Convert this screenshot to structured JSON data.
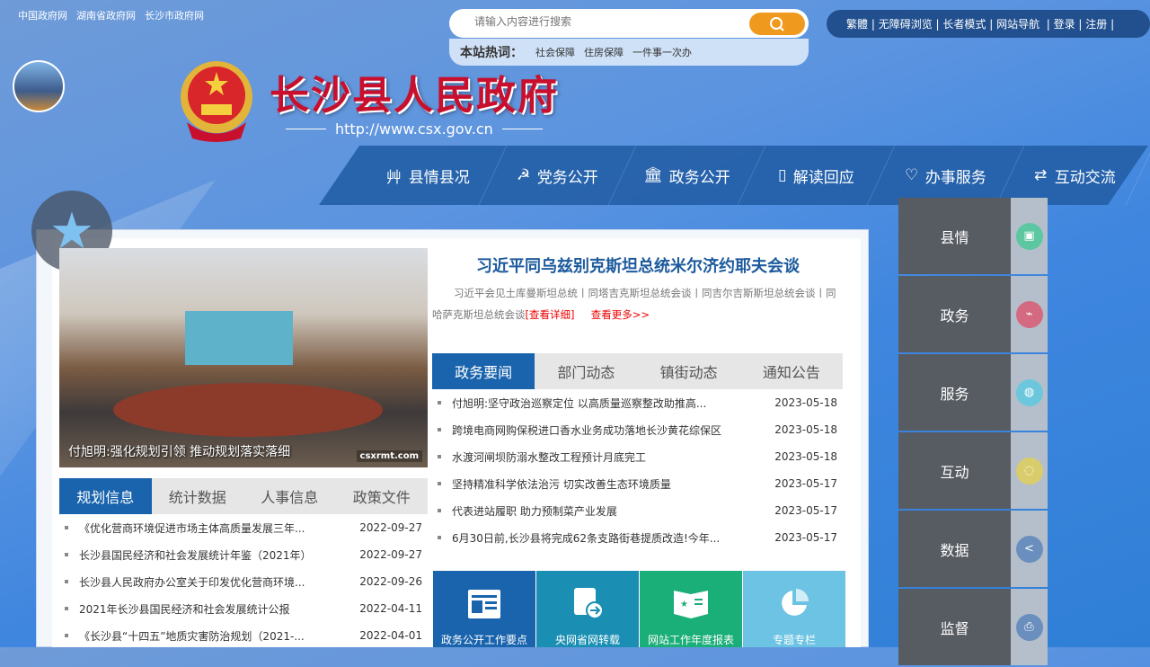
{
  "top_links": [
    "中国政府网",
    "湖南省政府网",
    "长沙市政府网"
  ],
  "search": {
    "placeholder": "请输入内容进行搜索"
  },
  "hot": {
    "label": "本站热词：",
    "words": [
      "社会保障",
      "住房保障",
      "一件事一次办"
    ]
  },
  "utility": [
    "繁體",
    "无障碍浏览",
    "长者模式",
    "网站导航",
    "登录",
    "注册"
  ],
  "site_title": "长沙县人民政府",
  "site_url": "http://www.csx.gov.cn",
  "nav": [
    "县情县况",
    "党务公开",
    "政务公开",
    "解读回应",
    "办事服务",
    "互动交流"
  ],
  "photo": {
    "caption": "付旭明:强化规划引领 推动规划落实落细",
    "watermark": "csxrmt.com"
  },
  "headline": {
    "title": "习近平同乌兹别克斯坦总统米尔济约耶夫会谈",
    "summary": "习近平会见土库曼斯坦总统丨同塔吉克斯坦总统会谈丨同吉尔吉斯斯坦总统会谈丨同哈萨克斯坦总统会谈",
    "detail": "[查看详细]",
    "more": "查看更多>>"
  },
  "news_tabs": [
    "政务要闻",
    "部门动态",
    "镇街动态",
    "通知公告"
  ],
  "news": [
    {
      "title": "付旭明:坚守政治巡察定位 以高质量巡察整改助推高...",
      "date": "2023-05-18"
    },
    {
      "title": "跨境电商网购保税进口香水业务成功落地长沙黄花综保区",
      "date": "2023-05-18"
    },
    {
      "title": "水渡河闸坝防溺水整改工程预计月底完工",
      "date": "2023-05-18"
    },
    {
      "title": "坚持精准科学依法治污 切实改善生态环境质量",
      "date": "2023-05-17"
    },
    {
      "title": "代表进站履职 助力预制菜产业发展",
      "date": "2023-05-17"
    },
    {
      "title": "6月30日前,长沙县将完成62条支路街巷提质改造!今年...",
      "date": "2023-05-17"
    }
  ],
  "info_tabs": [
    "规划信息",
    "统计数据",
    "人事信息",
    "政策文件"
  ],
  "info": [
    {
      "title": "《优化营商环境促进市场主体高质量发展三年...",
      "date": "2022-09-27"
    },
    {
      "title": "长沙县国民经济和社会发展统计年鉴（2021年）",
      "date": "2022-09-27"
    },
    {
      "title": "长沙县人民政府办公室关于印发优化营商环境...",
      "date": "2022-09-26"
    },
    {
      "title": "2021年长沙县国民经济和社会发展统计公报",
      "date": "2022-04-11"
    },
    {
      "title": "《长沙县“十四五”地质灾害防治规划（2021-...",
      "date": "2022-04-01"
    }
  ],
  "tiles": [
    {
      "label": "政务公开工作要点",
      "color": "#1a64ad"
    },
    {
      "label": "央网省网转载",
      "color": "#1a8fb3"
    },
    {
      "label": "网站工作年度报表",
      "color": "#1aae78"
    },
    {
      "label": "专题专栏",
      "color": "#6cc3e3"
    }
  ],
  "side": [
    {
      "label": "县情",
      "color": "#5cc7a0"
    },
    {
      "label": "政务",
      "color": "#d46a82"
    },
    {
      "label": "服务",
      "color": "#6cc7dc"
    },
    {
      "label": "互动",
      "color": "#d9cc6a"
    },
    {
      "label": "数据",
      "color": "#6a8fbe"
    },
    {
      "label": "监督",
      "color": "#6a8fbe"
    }
  ]
}
